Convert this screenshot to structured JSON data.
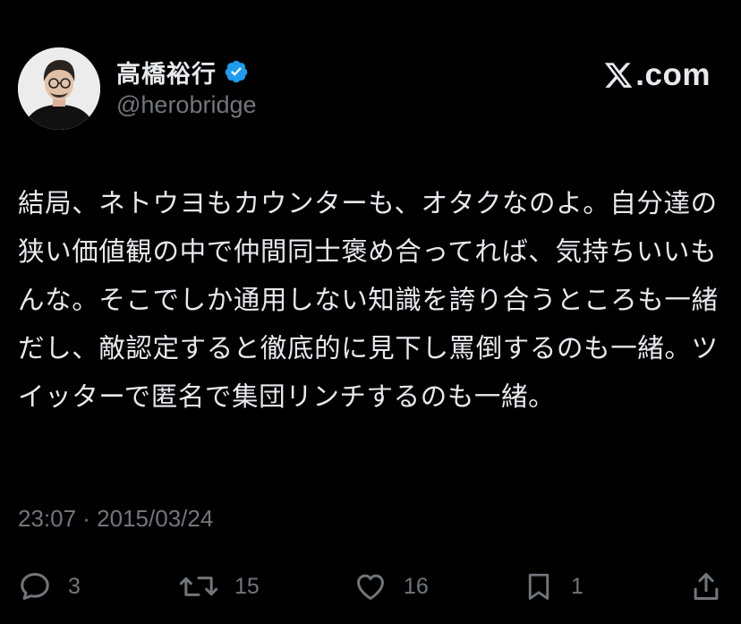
{
  "author": {
    "display_name": "高橋裕行",
    "handle": "@herobridge",
    "verified": true,
    "verified_color": "#1d9bf0"
  },
  "brand": {
    "text": ".com",
    "icon": "x-logo-icon"
  },
  "tweet": {
    "text": "結局、ネトウヨもカウンターも、オタクなのよ。自分達の狭い価値観の中で仲間同士褒め合ってれば、気持ちいいもんな。そこでしか通用しない知識を誇り合うところも一緒だし、敵認定すると徹底的に見下し罵倒するのも一緒。ツイッターで匿名で集団リンチするのも一緒。",
    "timestamp": "23:07 · 2015/03/24"
  },
  "actions": {
    "reply": {
      "icon": "reply-icon",
      "count": "3"
    },
    "repost": {
      "icon": "repost-icon",
      "count": "15"
    },
    "like": {
      "icon": "heart-icon",
      "count": "16"
    },
    "bookmark": {
      "icon": "bookmark-icon",
      "count": "1"
    },
    "share": {
      "icon": "share-icon"
    }
  },
  "colors": {
    "background": "#000000",
    "text": "#e7e9ea",
    "muted": "#71767b"
  }
}
